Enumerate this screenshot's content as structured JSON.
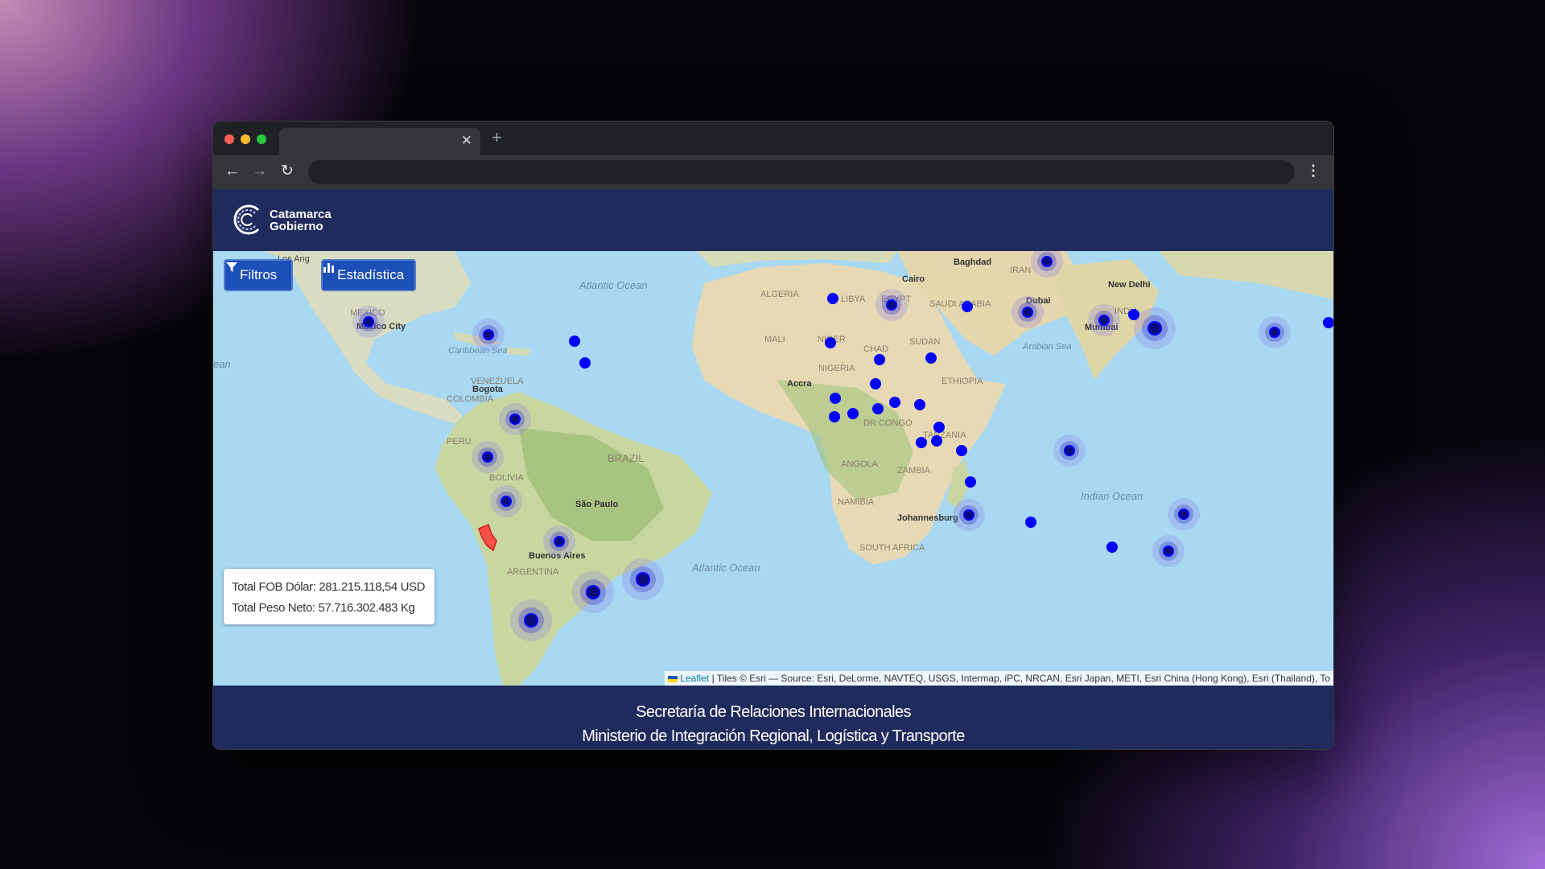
{
  "app": {
    "logo_line1": "Catamarca",
    "logo_line2": "Gobierno",
    "brand_color": "#1f2b5c",
    "button_color": "#1d4fb8"
  },
  "toolbar": {
    "filtros_label": "Filtros",
    "estadistica_label": "Estadística"
  },
  "totals": {
    "fob_label": "Total FOB Dólar:",
    "fob_value": "281.215.118,54 USD",
    "peso_label": "Total Peso Neto:",
    "peso_value": "57.716.302.483 Kg"
  },
  "map": {
    "marker_color": "#0000ff",
    "highlight_color": "#ff0000",
    "labels": {
      "los_angeles": "Los Ang",
      "mexico": "MEXICO",
      "mexico_city": "Mexico City",
      "atlantic_ocean_n": "Atlantic Ocean",
      "caribbean": "Caribbean Sea",
      "ocean_w": "ean",
      "venezuela": "VENEZUELA",
      "bogota": "Bogota",
      "colombia": "COLOMBIA",
      "peru": "PERU",
      "brazil": "BRAZIL",
      "bolivia": "BOLIVIA",
      "sao_paulo": "São Paulo",
      "buenos_aires": "Buenos Aires",
      "argentina": "ARGENTINA",
      "atlantic_ocean_s": "Atlantic Ocean",
      "algeria": "ALGERIA",
      "libya": "LIBYA",
      "egypt": "EGYPT",
      "cairo": "Cairo",
      "baghdad": "Baghdad",
      "iran": "IRAN",
      "saudi": "SAUDI ARABIA",
      "dubai": "Dubai",
      "new_delhi": "New Delhi",
      "india": "INDIA",
      "mumbai": "Mumbai",
      "arabian_sea": "Arabian Sea",
      "mali": "MALI",
      "niger": "NIGER",
      "chad": "CHAD",
      "sudan": "SUDAN",
      "nigeria": "NIGERIA",
      "accra": "Accra",
      "ethiopia": "ETHIOPIA",
      "dr_congo": "DR CONGO",
      "tanzania": "TANZANIA",
      "angola": "ANGOLA",
      "zambia": "ZAMBIA",
      "namibia": "NAMIBIA",
      "johannesburg": "Johannesburg",
      "south_africa": "SOUTH AFRICA",
      "indian_ocean": "Indian Ocean"
    }
  },
  "attribution": {
    "leaflet": "Leaflet",
    "text": "| Tiles © Esri — Source: Esri, DeLorme, NAVTEQ, USGS, Intermap, iPC, NRCAN, Esri Japan, METI, Esri China (Hong Kong), Esri (Thailand), To"
  },
  "footer": {
    "line1": "Secretaría de Relaciones Internacionales",
    "line2": "Ministerio de Integración Regional, Logística y Transporte"
  }
}
